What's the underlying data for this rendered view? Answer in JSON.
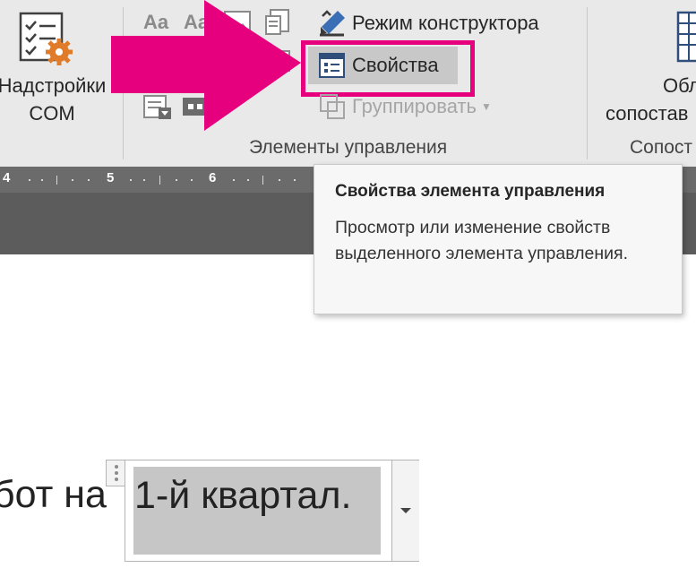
{
  "ribbon": {
    "addins_button_label_line1": "Надстройки",
    "addins_button_label_line2": "COM",
    "design_mode_label": "Режим конструктора",
    "properties_label": "Свойства",
    "group_label": "Группировать",
    "group_controls_label": "Элементы управления",
    "right_button_label_line1": "Обл",
    "right_button_label_line2": "сопостав",
    "right_group_label": "Сопост",
    "small_icon_text_1": "Aa",
    "small_icon_text_2": "Aa"
  },
  "ruler": {
    "labels": [
      "4",
      "5",
      "6"
    ]
  },
  "tooltip": {
    "title": "Свойства элемента управления",
    "body": "Просмотр или изменение свойств выделенного элемента управления."
  },
  "document": {
    "text_before": "бот на",
    "content_control_text": "1-й квартал."
  },
  "colors": {
    "highlight_box": "#e6007e",
    "arrow": "#e6007e",
    "ribbon_bg": "#e9e9e9",
    "ruler_bg": "#6b6b6b"
  }
}
